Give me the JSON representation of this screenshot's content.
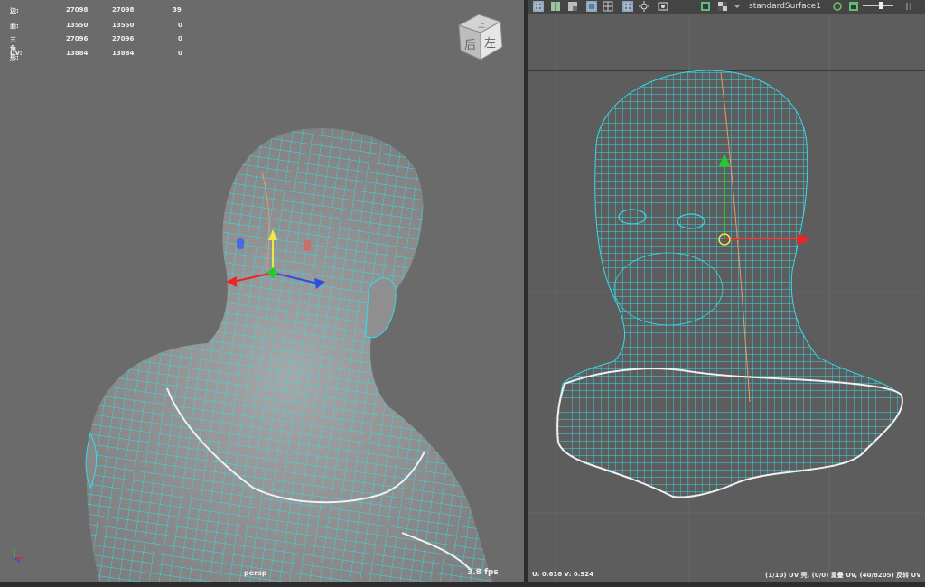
{
  "viewport": {
    "camera_label": "persp",
    "fps_label": "3.8 fps",
    "view_cube": {
      "top_face": "上",
      "front_face": "后",
      "right_face": "左"
    },
    "hud": {
      "rows": [
        {
          "label": "边:",
          "v1": "27098",
          "v2": "27098",
          "v3": "39"
        },
        {
          "label": "面:",
          "v1": "13550",
          "v2": "13550",
          "v3": "0"
        },
        {
          "label": "三角形:",
          "v1": "27096",
          "v2": "27096",
          "v3": "0"
        },
        {
          "label": "UV:",
          "v1": "13884",
          "v2": "13884",
          "v3": "0"
        }
      ]
    }
  },
  "uv_editor": {
    "toolbar": {
      "shader_name": "standardSurface1",
      "icons": [
        "grid-icon",
        "grid-shaded-icon",
        "grid-shaded-alt-icon",
        "grid-frame-icon",
        "grid-lines-icon",
        "grid-box-icon",
        "sun-icon",
        "screenshot-icon",
        "texture-swatch-icon",
        "checker-icon",
        "dropdown-arrow-icon",
        "refresh-icon",
        "image-icon",
        "slider-icon",
        "more-icon"
      ]
    },
    "status": {
      "uv_coords": "U:  0.616 V:  0.924",
      "selection_info": "(1/10) UV 壳, (0/0) 重叠 UV, (40/8205) 反转 UV"
    }
  },
  "colors": {
    "wire": "#33dcec",
    "bg3d": "#6b6b6b",
    "bguv": "#5d5d5d",
    "axis_x": "#e82626",
    "axis_y": "#27c92d",
    "axis_z": "#2b4fe0",
    "axis_yellow": "#f1e64a"
  }
}
